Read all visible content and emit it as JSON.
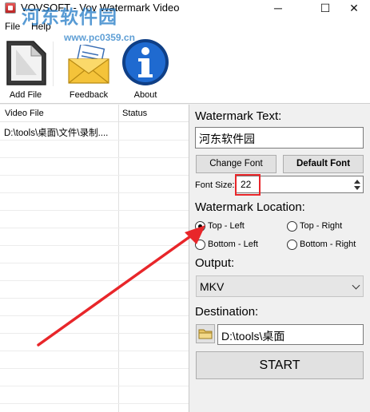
{
  "window": {
    "title": "VOVSOFT - Vov Watermark Video",
    "controls": {
      "minimize": "─",
      "maximize": "☐",
      "close": "✕"
    }
  },
  "menu": {
    "file": "File",
    "help": "Help"
  },
  "overlay": {
    "logo_text": "河东软件园",
    "url": "www.pc0359.cn"
  },
  "toolbar": {
    "add_file": "Add File",
    "feedback": "Feedback",
    "about": "About"
  },
  "file_list": {
    "columns": {
      "file": "Video File",
      "status": "Status"
    },
    "rows": [
      {
        "file": "D:\\tools\\桌面\\文件\\录制....",
        "status": ""
      }
    ]
  },
  "watermark": {
    "text_label": "Watermark Text:",
    "text_value": "河东软件园",
    "change_font": "Change Font",
    "default_font": "Default Font",
    "font_size_label": "Font Size:",
    "font_size_value": "22"
  },
  "location": {
    "label": "Watermark Location:",
    "options": [
      {
        "label": "Top - Left",
        "selected": true
      },
      {
        "label": "Top - Right",
        "selected": false
      },
      {
        "label": "Bottom - Left",
        "selected": false
      },
      {
        "label": "Bottom - Right",
        "selected": false
      }
    ]
  },
  "output": {
    "label": "Output:",
    "value": "MKV"
  },
  "destination": {
    "label": "Destination:",
    "value": "D:\\tools\\桌面"
  },
  "start": {
    "label": "START"
  },
  "colors": {
    "annotation": "#e8262a",
    "logo_blue": "#2a7fc8"
  },
  "icons": {
    "add_file": "document-icon",
    "feedback": "envelope-icon",
    "about": "info-icon",
    "folder": "folder-icon"
  }
}
